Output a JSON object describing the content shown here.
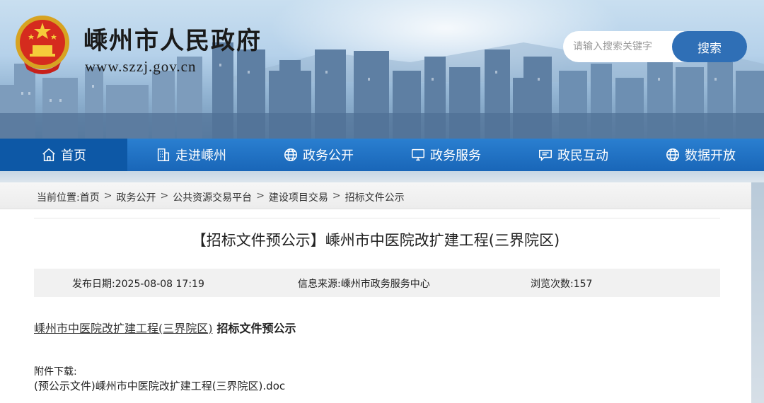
{
  "header": {
    "site_name": "嵊州市人民政府",
    "site_url": "www.szzj.gov.cn",
    "emblem": "national-emblem"
  },
  "search": {
    "placeholder": "请输入搜索关键字",
    "button_label": "搜索"
  },
  "nav": {
    "items": [
      {
        "label": "首页",
        "icon": "home-icon",
        "active": true
      },
      {
        "label": "走进嵊州",
        "icon": "building-icon",
        "active": false
      },
      {
        "label": "政务公开",
        "icon": "globe-icon",
        "active": false
      },
      {
        "label": "政务服务",
        "icon": "monitor-icon",
        "active": false
      },
      {
        "label": "政民互动",
        "icon": "chat-icon",
        "active": false
      },
      {
        "label": "数据开放",
        "icon": "globe-icon",
        "active": false
      }
    ]
  },
  "breadcrumb": {
    "prefix": "当前位置:",
    "items": [
      "首页",
      "政务公开",
      "公共资源交易平台",
      "建设项目交易",
      "招标文件公示"
    ],
    "separator": ">"
  },
  "article": {
    "title": "【招标文件预公示】嵊州市中医院改扩建工程(三界院区)",
    "publish_date": "发布日期:2025-08-08 17:19",
    "source": "信息来源:嵊州市政务服务中心",
    "views": "浏览次数:157",
    "body_link": "嵊州市中医院改扩建工程(三界院区)",
    "body_bold": "招标文件预公示",
    "attachment_label": "附件下载:",
    "attachment_file": "(预公示文件)嵊州市中医院改扩建工程(三界院区).doc"
  },
  "colors": {
    "nav_bg": "#1966b8",
    "nav_active": "#0d58a6",
    "search_button": "#2f6fb6"
  }
}
